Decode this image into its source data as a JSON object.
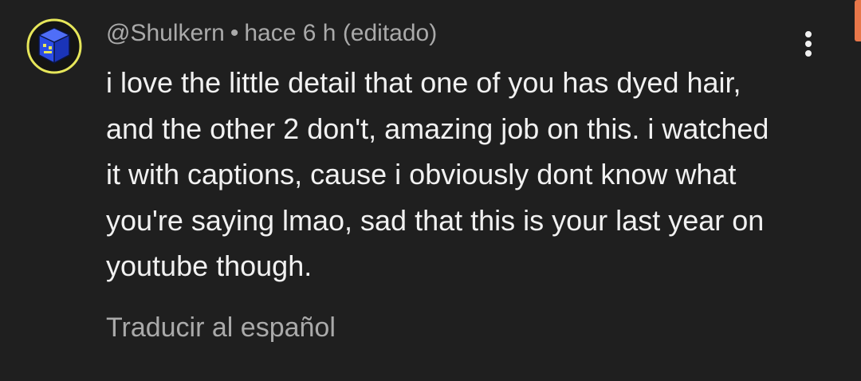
{
  "comment": {
    "author": "@Shulkern",
    "separator": "•",
    "time": "hace 6 h",
    "edited": "(editado)",
    "text": "i love the little detail that one of you has dyed hair, and the other 2 don't, amazing job on this. i watched it with captions, cause i obviously dont know what you're saying lmao, sad that this is your last year on youtube though.",
    "translate_label": "Traducir al español",
    "avatar_icon": "geometry-dash-cube-icon",
    "menu_icon": "more-vertical-icon"
  },
  "colors": {
    "background": "#1f1f1f",
    "primary_text": "#f1f1f1",
    "secondary_text": "#aaaaaa",
    "avatar_ring": "#e6e65a",
    "cube_blue": "#2b4de6",
    "edge_accent": "#e8774a"
  }
}
